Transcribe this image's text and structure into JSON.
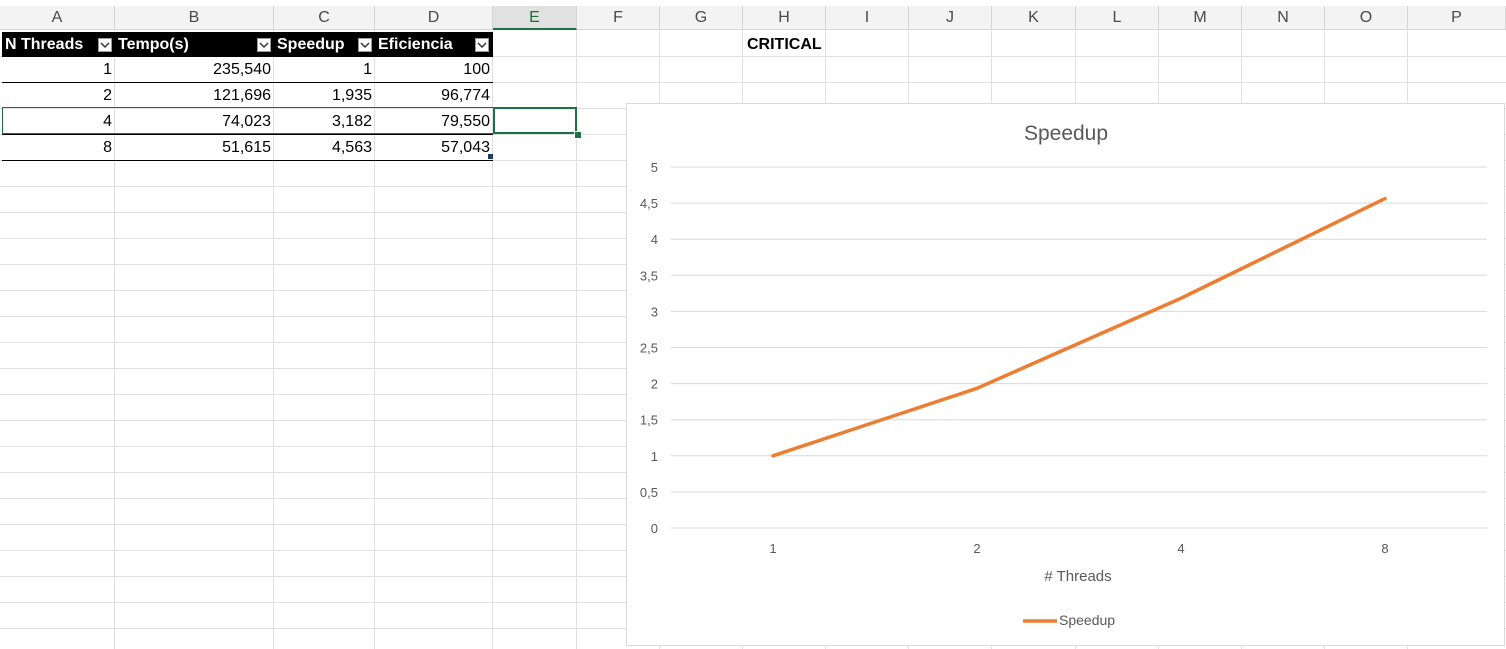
{
  "sheet": {
    "columns": [
      "A",
      "B",
      "C",
      "D",
      "E",
      "F",
      "G",
      "H",
      "I",
      "J",
      "K",
      "L",
      "M",
      "N",
      "O",
      "P"
    ],
    "selected_column": "E",
    "table": {
      "headers": [
        "N Threads",
        "Tempo(s)",
        "Speedup",
        "Eficiencia"
      ],
      "rows": [
        [
          "1",
          "235,540",
          "1",
          "100"
        ],
        [
          "2",
          "121,696",
          "1,935",
          "96,774"
        ],
        [
          "4",
          "74,023",
          "3,182",
          "79,550"
        ],
        [
          "8",
          "51,615",
          "4,563",
          "57,043"
        ]
      ]
    },
    "critical_label": "CRITICAL"
  },
  "colors": {
    "series": "#ed7d31",
    "table_header_bg": "#000000",
    "selection": "#1e7145"
  },
  "chart_data": {
    "type": "line",
    "title": "Speedup",
    "xlabel": "# Threads",
    "ylabel": "",
    "categories": [
      "1",
      "2",
      "4",
      "8"
    ],
    "series": [
      {
        "name": "Speedup",
        "values": [
          1,
          1.935,
          3.182,
          4.563
        ]
      }
    ],
    "ylim": [
      0,
      5
    ],
    "yticks": [
      "0",
      "0,5",
      "1",
      "1,5",
      "2",
      "2,5",
      "3",
      "3,5",
      "4",
      "4,5",
      "5"
    ],
    "grid": true,
    "legend": "bottom"
  }
}
